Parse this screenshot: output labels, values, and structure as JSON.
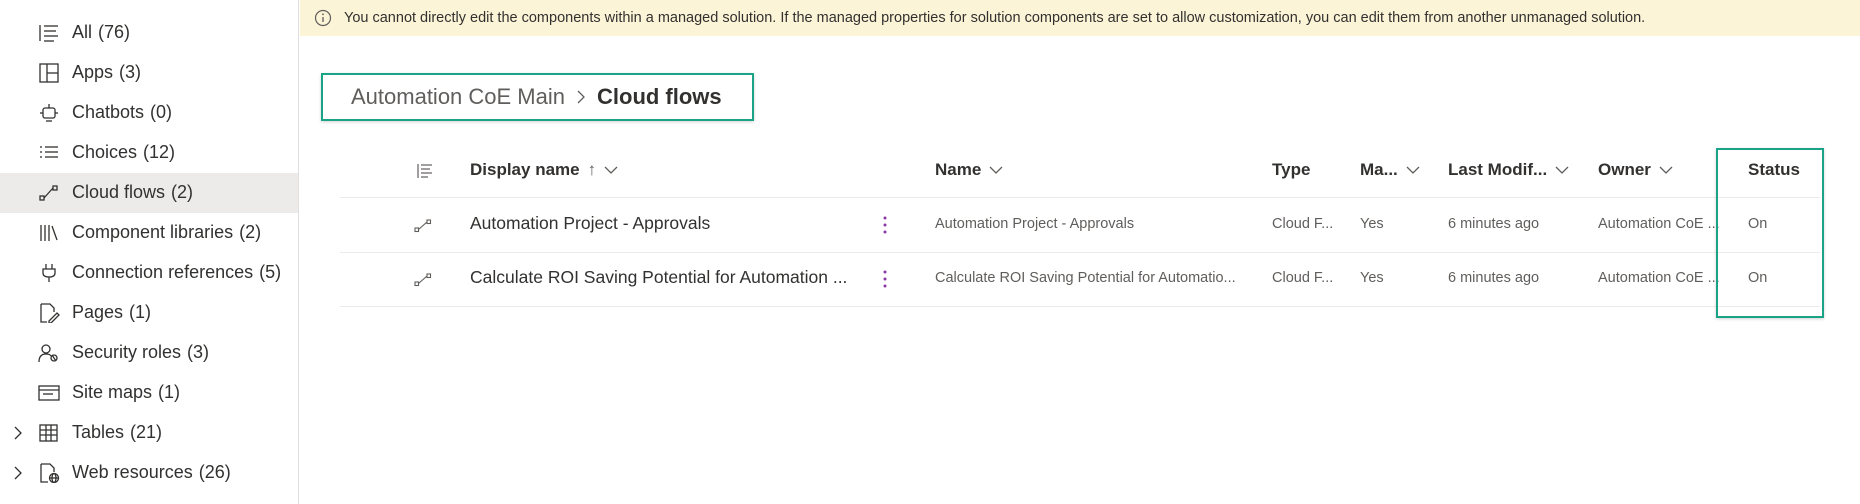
{
  "sidebar": {
    "items": [
      {
        "label": "All",
        "count": "(76)",
        "icon": "list-icon",
        "selected": false,
        "expandable": false
      },
      {
        "label": "Apps",
        "count": "(3)",
        "icon": "app-icon",
        "selected": false,
        "expandable": false
      },
      {
        "label": "Chatbots",
        "count": "(0)",
        "icon": "bot-icon",
        "selected": false,
        "expandable": false
      },
      {
        "label": "Choices",
        "count": "(12)",
        "icon": "choices-icon",
        "selected": false,
        "expandable": false
      },
      {
        "label": "Cloud flows",
        "count": "(2)",
        "icon": "flow-icon",
        "selected": true,
        "expandable": false
      },
      {
        "label": "Component libraries",
        "count": "(2)",
        "icon": "library-icon",
        "selected": false,
        "expandable": false
      },
      {
        "label": "Connection references",
        "count": "(5)",
        "icon": "plug-icon",
        "selected": false,
        "expandable": false
      },
      {
        "label": "Pages",
        "count": "(1)",
        "icon": "page-edit-icon",
        "selected": false,
        "expandable": false
      },
      {
        "label": "Security roles",
        "count": "(3)",
        "icon": "people-icon",
        "selected": false,
        "expandable": false
      },
      {
        "label": "Site maps",
        "count": "(1)",
        "icon": "sitemap-icon",
        "selected": false,
        "expandable": false
      },
      {
        "label": "Tables",
        "count": "(21)",
        "icon": "table-icon",
        "selected": false,
        "expandable": true
      },
      {
        "label": "Web resources",
        "count": "(26)",
        "icon": "web-resource-icon",
        "selected": false,
        "expandable": true
      }
    ]
  },
  "banner": {
    "message": "You cannot directly edit the components within a managed solution. If the managed properties for solution components are set to allow customization, you can edit them from another unmanaged solution."
  },
  "breadcrumb": {
    "parent": "Automation CoE Main",
    "current": "Cloud flows"
  },
  "grid": {
    "columns": {
      "display_name": "Display name",
      "name": "Name",
      "type": "Type",
      "managed": "Ma...",
      "last_modified": "Last Modif...",
      "owner": "Owner",
      "status": "Status"
    },
    "rows": [
      {
        "display_name": "Automation Project - Approvals",
        "name": "Automation Project - Approvals",
        "type": "Cloud F...",
        "managed": "Yes",
        "last_modified": "6 minutes ago",
        "owner": "Automation CoE ...",
        "status": "On"
      },
      {
        "display_name": "Calculate ROI Saving Potential for Automation ...",
        "name": "Calculate ROI Saving Potential for Automatio...",
        "type": "Cloud F...",
        "managed": "Yes",
        "last_modified": "6 minutes ago",
        "owner": "Automation CoE ...",
        "status": "On"
      }
    ]
  },
  "colors": {
    "highlight_border": "#1aa386",
    "banner_bg": "#fcf4d6",
    "selected_bg": "#edebe9",
    "more_dots": "#8a3aa5"
  }
}
